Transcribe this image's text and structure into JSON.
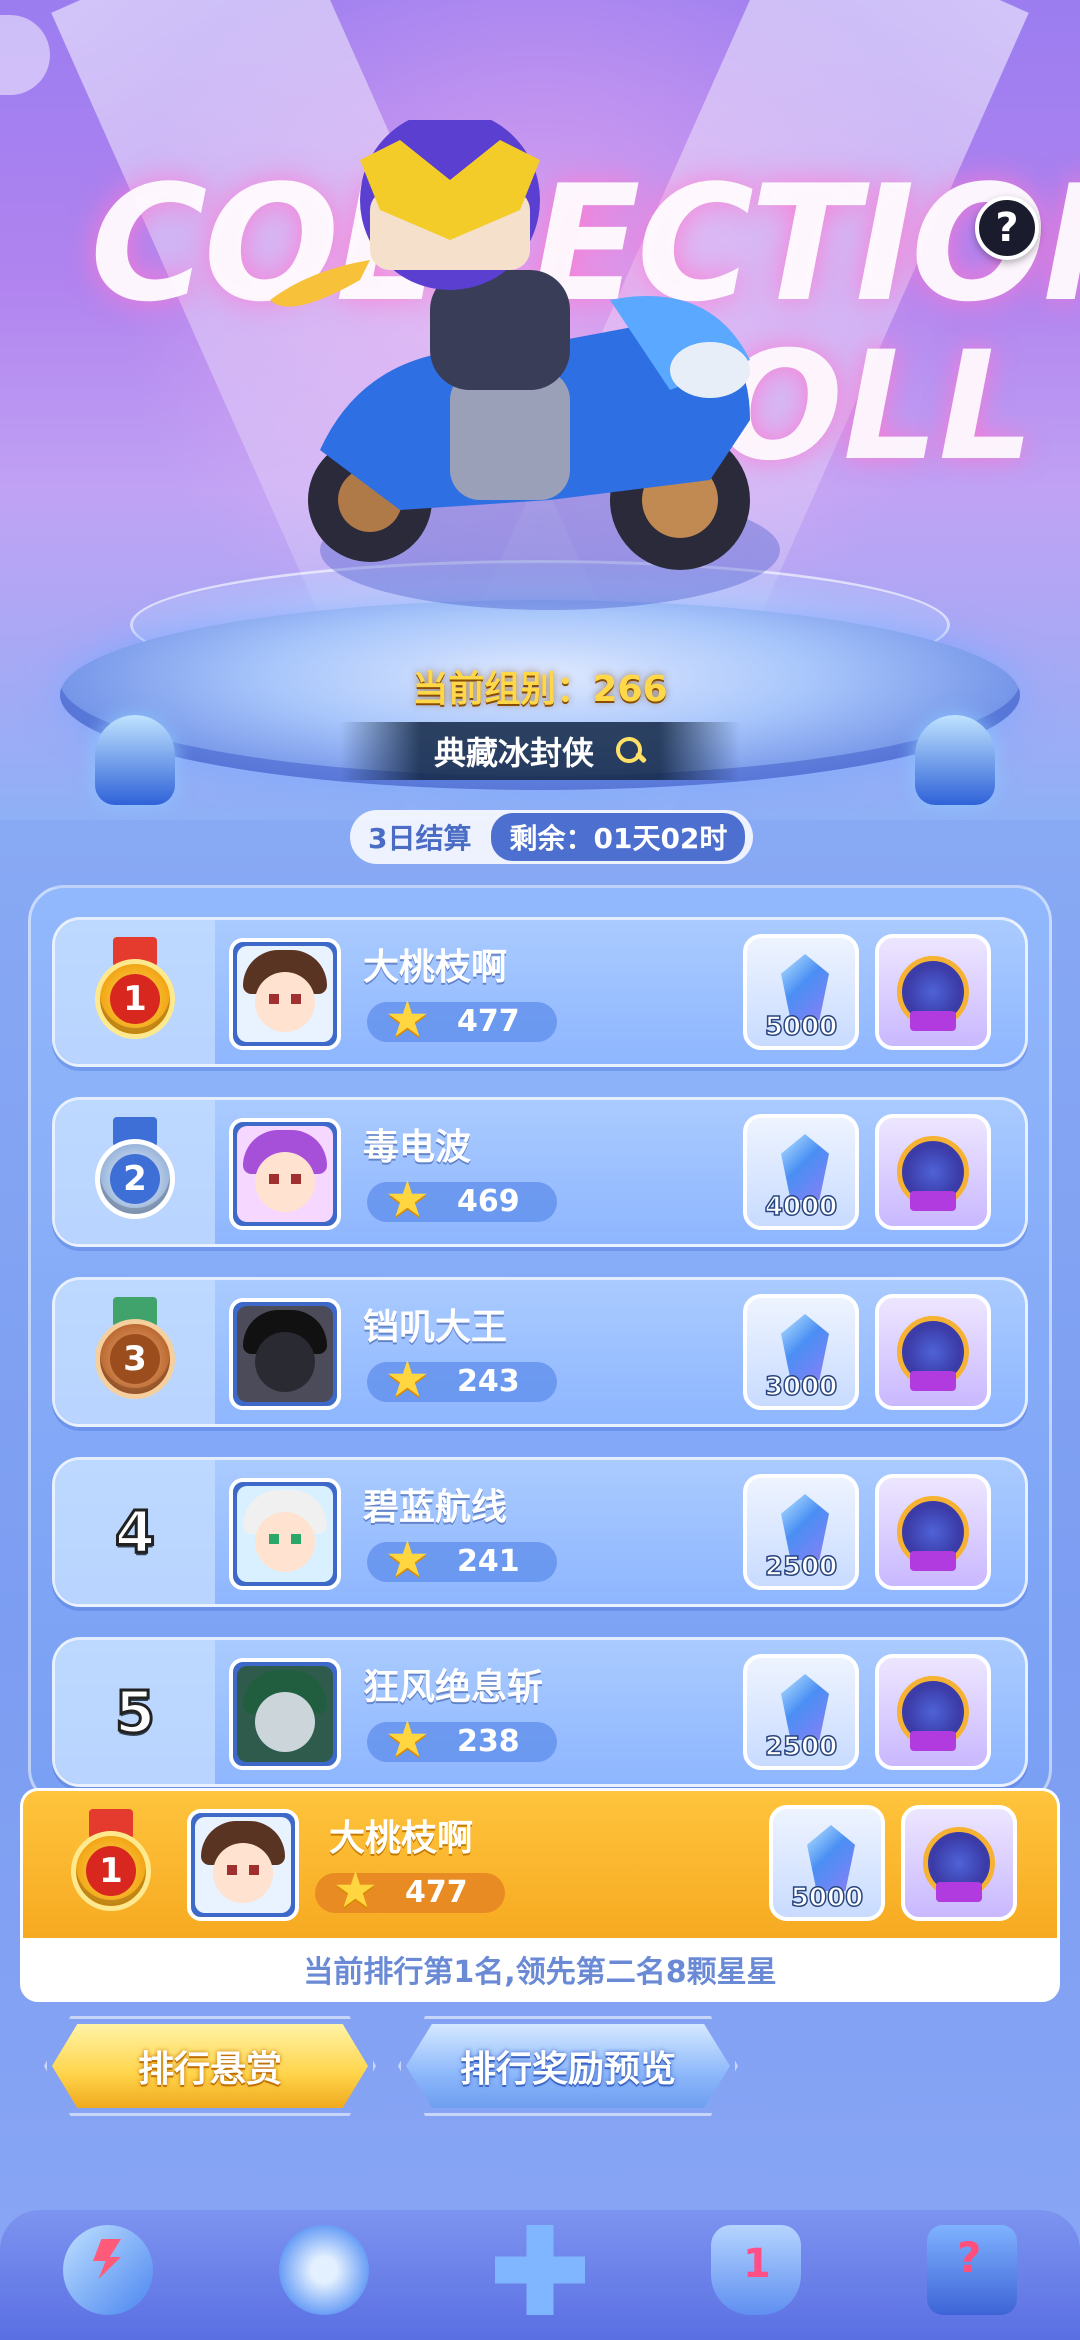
{
  "hero": {
    "title_line1": "COLLECTION",
    "title_line2": "ROLL",
    "help_label": "?",
    "group_label": "当前组别：266",
    "collection_name": "典藏冰封侠",
    "search_icon": "search-icon"
  },
  "settlement": {
    "cycle": "3日结算",
    "remaining": "剩余：01天02时"
  },
  "ranking": {
    "rows": [
      {
        "rank": "1",
        "name": "大桃枝啊",
        "score": "477",
        "gem_reward": "5000"
      },
      {
        "rank": "2",
        "name": "毒电波",
        "score": "469",
        "gem_reward": "4000"
      },
      {
        "rank": "3",
        "name": "铛叽大王",
        "score": "243",
        "gem_reward": "3000"
      },
      {
        "rank": "4",
        "name": "碧蓝航线",
        "score": "241",
        "gem_reward": "2500"
      },
      {
        "rank": "5",
        "name": "狂风绝息斩",
        "score": "238",
        "gem_reward": "2500"
      }
    ]
  },
  "my_rank": {
    "rank": "1",
    "name": "大桃枝啊",
    "score": "477",
    "gem_reward": "5000",
    "lead_text": "当前排行第1名,领先第二名8颗星星"
  },
  "buttons": {
    "rank_reward": "排行悬赏",
    "rank_preview": "排行奖励预览"
  },
  "nav": {
    "items": [
      "speed-arrow-icon",
      "whistle-icon",
      "gamepad-icon",
      "trophy-icon",
      "help-machine-icon"
    ]
  },
  "colors": {
    "gold": "#ffc43d",
    "panel_blue": "#8eb6ff",
    "group_label": "#ffd84a"
  }
}
